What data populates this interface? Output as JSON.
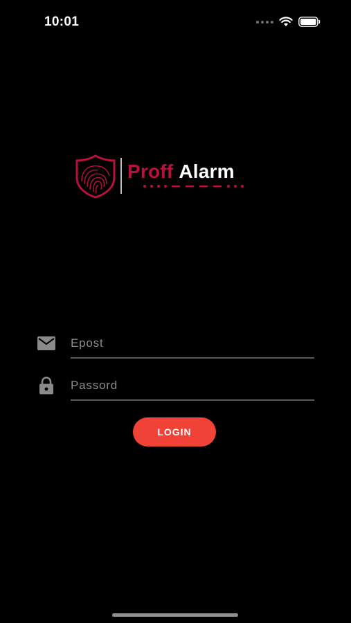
{
  "status_bar": {
    "time": "10:01"
  },
  "logo": {
    "brand_first": "Proff",
    "brand_second": "Alarm",
    "brand_color": "#b8123c"
  },
  "form": {
    "email_placeholder": "Epost",
    "email_value": "",
    "email_icon": "envelope-icon",
    "password_placeholder": "Passord",
    "password_value": "",
    "password_icon": "lock-icon",
    "login_label": "LOGIN",
    "login_color": "#f04236"
  }
}
